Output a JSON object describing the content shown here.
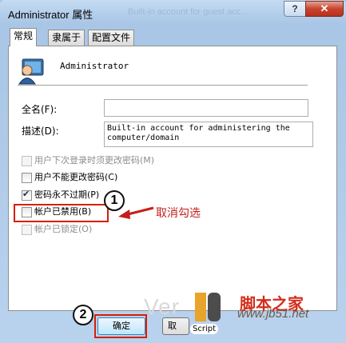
{
  "window": {
    "title": "Administrator 属性",
    "ghost_title": "Built-in account for guest acc...",
    "help_label": "?",
    "close_label": "✕"
  },
  "tabs": [
    {
      "label": "常规"
    },
    {
      "label": "隶属于"
    },
    {
      "label": "配置文件"
    }
  ],
  "general": {
    "username": "Administrator",
    "fullname_label": "全名(F):",
    "fullname_value": "",
    "description_label": "描述(D):",
    "description_value": "Built-in account for administering the\ncomputer/domain"
  },
  "checkboxes": [
    {
      "label": "用户下次登录时须更改密码(M)",
      "checked": false,
      "enabled": false
    },
    {
      "label": "用户不能更改密码(C)",
      "checked": false,
      "enabled": true
    },
    {
      "label": "密码永不过期(P)",
      "checked": true,
      "enabled": true
    },
    {
      "label": "帐户已禁用(B)",
      "checked": false,
      "enabled": true
    },
    {
      "label": "帐户已锁定(O)",
      "checked": false,
      "enabled": false
    }
  ],
  "annotations": {
    "step1": "1",
    "step2": "2",
    "uncheck_note": "取消勾选"
  },
  "buttons": {
    "ok": "确定",
    "cancel": "取"
  },
  "watermark": {
    "site_cn": "脚本之家",
    "site_url": "www.jb51.net",
    "script_word": "Script",
    "ghost_text": "Ver"
  },
  "colors": {
    "annotation_red": "#d81e05",
    "titlebar_blue": "#a9c6e6"
  }
}
